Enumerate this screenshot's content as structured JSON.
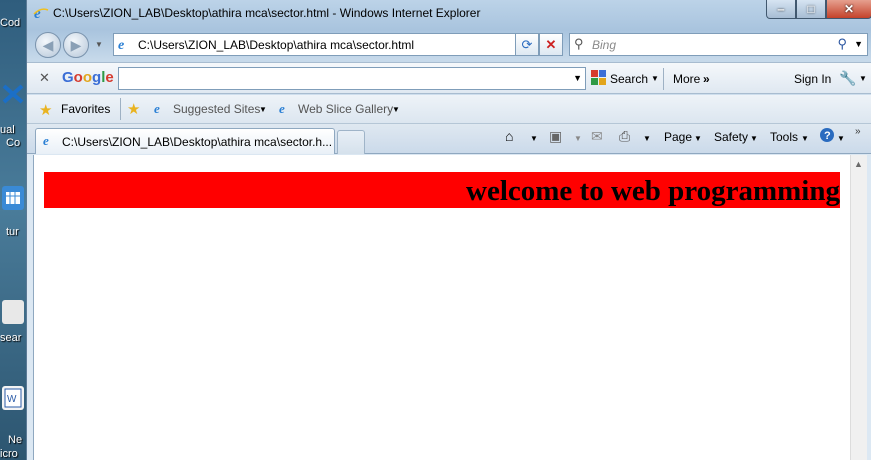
{
  "desktop": {
    "labels": [
      "Cod",
      "ual",
      "Co",
      "tur",
      "sear",
      "Ne",
      "icro"
    ]
  },
  "window": {
    "title": "C:\\Users\\ZION_LAB\\Desktop\\athira mca\\sector.html - Windows Internet Explorer",
    "controls": {
      "minimize": "‒",
      "maximize": "□",
      "close": "✕"
    }
  },
  "address_bar": {
    "url": "C:\\Users\\ZION_LAB\\Desktop\\athira mca\\sector.html",
    "search_placeholder": "Bing"
  },
  "google_toolbar": {
    "logo": [
      "G",
      "o",
      "o",
      "g",
      "l",
      "e"
    ],
    "search_label": "Search",
    "more_label": "More",
    "sign_in_label": "Sign In"
  },
  "favorites_bar": {
    "favorites_label": "Favorites",
    "items": [
      "Suggested Sites",
      "Web Slice Gallery"
    ]
  },
  "tabs": {
    "active_tab_label": "C:\\Users\\ZION_LAB\\Desktop\\athira mca\\sector.h...",
    "commands": [
      "Page",
      "Safety",
      "Tools"
    ]
  },
  "page": {
    "heading": "welcome to web programming",
    "banner_color": "#ff0000"
  }
}
